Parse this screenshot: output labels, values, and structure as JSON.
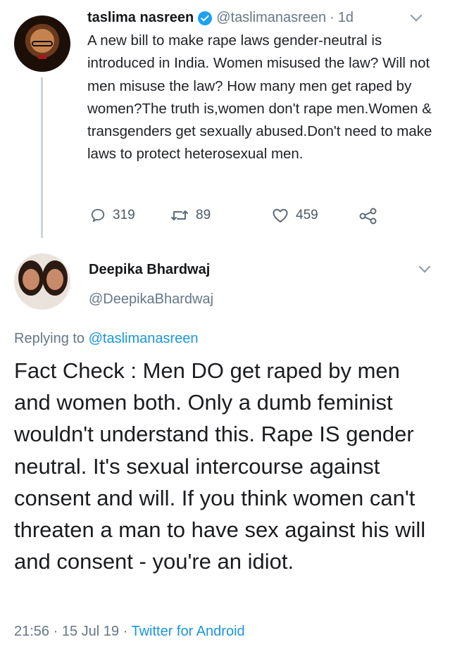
{
  "tweet1": {
    "author_name": "taslima nasreen",
    "verified_icon": "verified-badge-icon",
    "handle": "@taslimanasreen",
    "separator": "·",
    "time": "1d",
    "text": "A new bill to make rape laws gender-neutral is introduced in India. Women misused the law? Will not men misuse the law? How many men get raped by women?The truth is,women don't rape men.Women & transgenders get sexually abused.Don't need to make laws to protect heterosexual men.",
    "actions": {
      "replies": "319",
      "retweets": "89",
      "likes": "459"
    }
  },
  "tweet2": {
    "author_name": "Deepika Bhardwaj",
    "handle": "@DeepikaBhardwaj",
    "replying_prefix": "Replying to",
    "replying_handle": "@taslimanasreen",
    "text": "Fact Check : Men DO get raped by men and women both. Only a dumb feminist wouldn't understand this. Rape IS gender neutral. It's sexual intercourse against consent and will. If you think women can't threaten a man to have sex against his will and consent - you're an idiot.",
    "time": "21:56",
    "separator1": "·",
    "date": "15 Jul 19",
    "separator2": "·",
    "source": "Twitter for Android"
  },
  "colors": {
    "accent": "#1da1f2",
    "link": "#1b95e0",
    "muted": "#657786",
    "text": "#14171a"
  }
}
